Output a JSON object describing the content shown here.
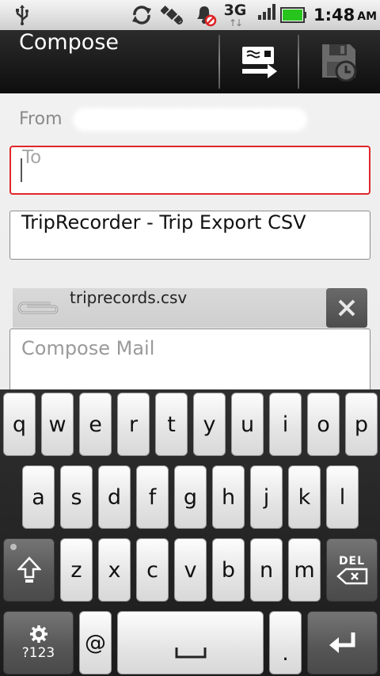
{
  "status_bar": {
    "network_type": "3G",
    "network_activity": "↑↓",
    "time": "1:48",
    "ampm": "AM",
    "battery_color": "#28c41e",
    "icons": [
      "usb-icon",
      "sync-icon",
      "gps-icon",
      "alarm-off-icon",
      "signal-icon",
      "battery-icon"
    ]
  },
  "title_bar": {
    "title": "Compose",
    "actions": [
      {
        "name": "send-button",
        "icon": "send-icon"
      },
      {
        "name": "save-draft-button",
        "icon": "save-draft-icon"
      }
    ]
  },
  "compose": {
    "from_label": "From",
    "to_placeholder": "To",
    "subject": "TripRecorder - Trip Export CSV",
    "attachment": {
      "name": "triprecords.csv",
      "icon": "paperclip-icon"
    },
    "body_placeholder": "Compose Mail",
    "focus_color": "#e0262c"
  },
  "keyboard": {
    "row1": [
      "q",
      "w",
      "e",
      "r",
      "t",
      "y",
      "u",
      "i",
      "o",
      "p"
    ],
    "row2": [
      "a",
      "s",
      "d",
      "f",
      "g",
      "h",
      "j",
      "k",
      "l"
    ],
    "row3": [
      "z",
      "x",
      "c",
      "v",
      "b",
      "n",
      "m"
    ],
    "delete_label": "DEL",
    "symbols_label": "?123",
    "at": "@",
    "period": "."
  }
}
